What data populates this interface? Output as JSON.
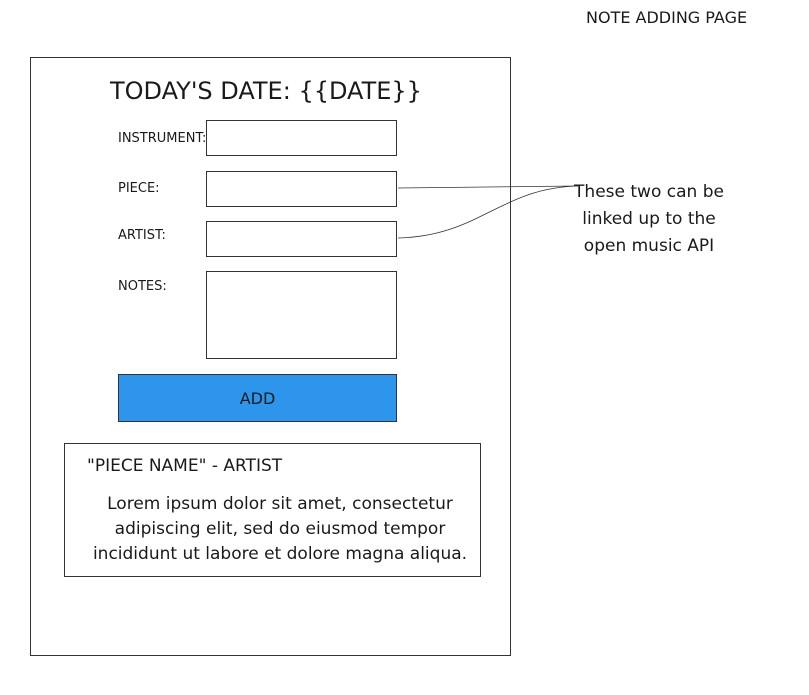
{
  "page": {
    "title": "NOTE ADDING PAGE"
  },
  "form": {
    "date_heading": "TODAY'S DATE: {{DATE}}",
    "fields": [
      {
        "label": "INSTRUMENT:",
        "value": ""
      },
      {
        "label": "PIECE:",
        "value": ""
      },
      {
        "label": "ARTIST:",
        "value": ""
      },
      {
        "label": "NOTES:",
        "value": ""
      }
    ],
    "add_button_label": "ADD"
  },
  "note_card": {
    "title": "\"PIECE NAME\" - ARTIST",
    "body": "Lorem ipsum dolor sit amet, consectetur adipiscing elit, sed do eiusmod tempor incididunt ut labore et dolore magna aliqua."
  },
  "annotation": {
    "text": "These two can be linked up to the open music API"
  },
  "colors": {
    "button_fill": "#2d96ec",
    "border": "#333333"
  }
}
